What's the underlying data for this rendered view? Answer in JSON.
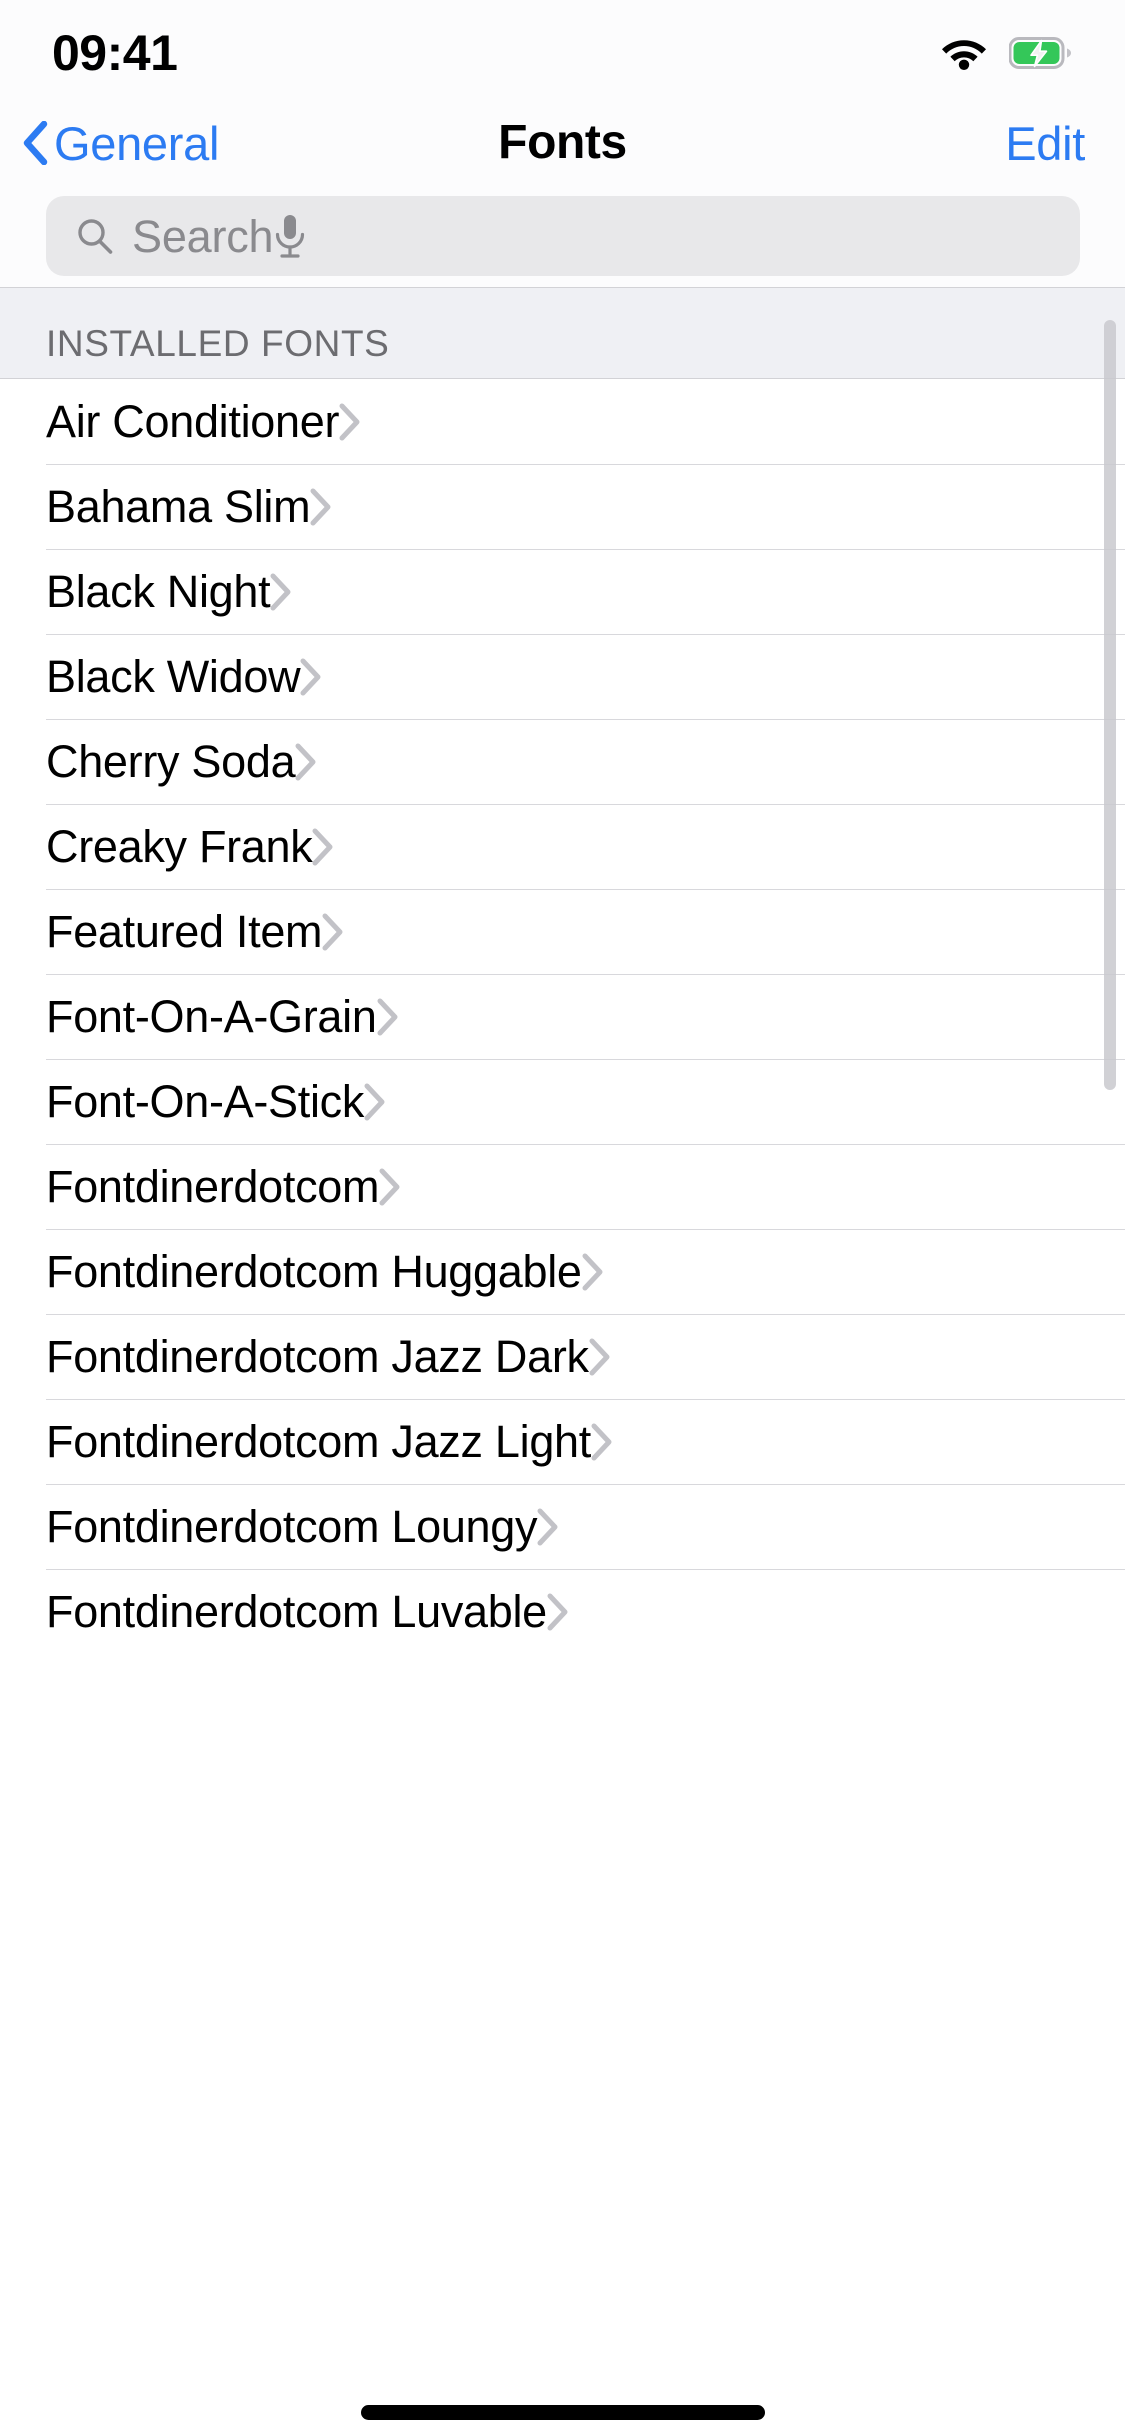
{
  "status_bar": {
    "time": "09:41",
    "wifi_icon": "wifi-icon",
    "battery_icon": "battery-charging-icon",
    "battery_color": "#34c759"
  },
  "nav_bar": {
    "back_label": "General",
    "back_icon": "chevron-left-icon",
    "title": "Fonts",
    "edit_label": "Edit",
    "accent_color": "#2c7bf2"
  },
  "search": {
    "placeholder": "Search",
    "search_icon": "search-icon",
    "mic_icon": "microphone-icon",
    "value": ""
  },
  "section": {
    "header": "INSTALLED FONTS"
  },
  "fonts": [
    {
      "name": "Air Conditioner"
    },
    {
      "name": "Bahama Slim"
    },
    {
      "name": "Black Night"
    },
    {
      "name": "Black Widow"
    },
    {
      "name": "Cherry Soda"
    },
    {
      "name": "Creaky Frank"
    },
    {
      "name": "Featured Item"
    },
    {
      "name": "Font-On-A-Grain"
    },
    {
      "name": "Font-On-A-Stick"
    },
    {
      "name": "Fontdinerdotcom"
    },
    {
      "name": "Fontdinerdotcom Huggable"
    },
    {
      "name": "Fontdinerdotcom Jazz Dark"
    },
    {
      "name": "Fontdinerdotcom Jazz Light"
    },
    {
      "name": "Fontdinerdotcom Loungy"
    },
    {
      "name": "Fontdinerdotcom Luvable"
    }
  ],
  "row_disclosure_icon": "chevron-right-icon"
}
